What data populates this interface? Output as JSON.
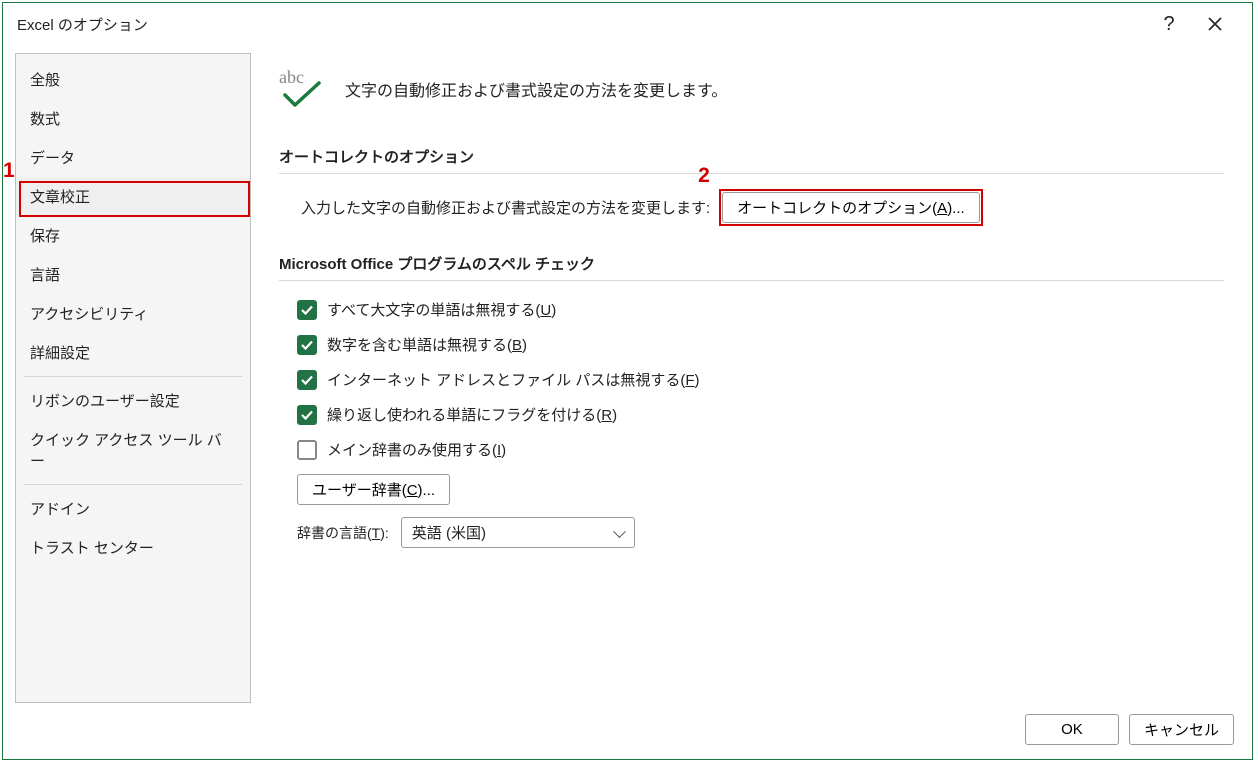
{
  "title": "Excel のオプション",
  "sidebar": {
    "items": [
      {
        "label": "全般"
      },
      {
        "label": "数式"
      },
      {
        "label": "データ"
      },
      {
        "label": "文章校正",
        "selected": true
      },
      {
        "label": "保存"
      },
      {
        "label": "言語"
      },
      {
        "label": "アクセシビリティ"
      },
      {
        "label": "詳細設定"
      },
      {
        "label": "リボンのユーザー設定"
      },
      {
        "label": "クイック アクセス ツール バー"
      },
      {
        "label": "アドイン"
      },
      {
        "label": "トラスト センター"
      }
    ]
  },
  "header": {
    "desc": "文字の自動修正および書式設定の方法を変更します。"
  },
  "autocorrect": {
    "section_title": "オートコレクトのオプション",
    "row_label": "入力した文字の自動修正および書式設定の方法を変更します:",
    "button_prefix": "オートコレクトのオプション(",
    "button_key": "A",
    "button_suffix": ")..."
  },
  "spelling": {
    "section_title": "Microsoft Office プログラムのスペル チェック",
    "checks": [
      {
        "label_prefix": "すべて大文字の単語は無視する(",
        "key": "U",
        "label_suffix": ")",
        "checked": true
      },
      {
        "label_prefix": "数字を含む単語は無視する(",
        "key": "B",
        "label_suffix": ")",
        "checked": true
      },
      {
        "label_prefix": "インターネット アドレスとファイル パスは無視する(",
        "key": "F",
        "label_suffix": ")",
        "checked": true
      },
      {
        "label_prefix": "繰り返し使われる単語にフラグを付ける(",
        "key": "R",
        "label_suffix": ")",
        "checked": true
      },
      {
        "label_prefix": "メイン辞書のみ使用する(",
        "key": "I",
        "label_suffix": ")",
        "checked": false
      }
    ],
    "user_dict_prefix": "ユーザー辞書(",
    "user_dict_key": "C",
    "user_dict_suffix": ")...",
    "dict_lang_label_prefix": "辞書の言語(",
    "dict_lang_key": "T",
    "dict_lang_label_suffix": "):",
    "dict_lang_value": "英語 (米国)"
  },
  "footer": {
    "ok": "OK",
    "cancel": "キャンセル"
  },
  "annotations": {
    "one": "1",
    "two": "2"
  }
}
